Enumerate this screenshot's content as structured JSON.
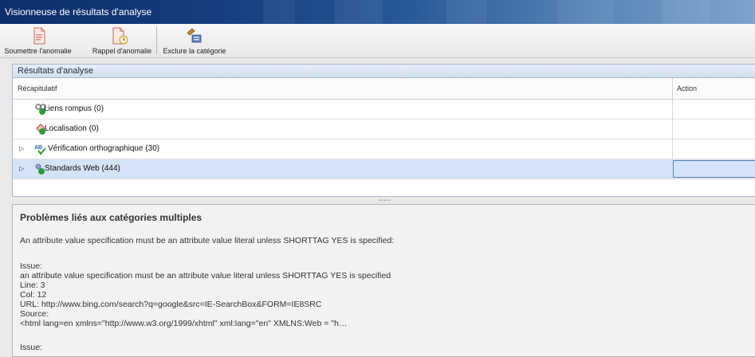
{
  "window": {
    "title": "Visionneuse de résultats d'analyse"
  },
  "toolbar": {
    "submit_label": "Soumettre l'anomalie",
    "recall_label": "Rappel d'anomalie",
    "exclude_label": "Exclure la catégorie"
  },
  "results": {
    "title": "Résultats d'analyse",
    "columns": {
      "summary": "Récapitulatif",
      "action": "Action"
    },
    "rows": [
      {
        "label": "Liens rompus (0)",
        "icon": "broken-links-icon",
        "expandable": false
      },
      {
        "label": "Localisation (0)",
        "icon": "localization-icon",
        "expandable": false
      },
      {
        "label": "Vérification orthographique (30)",
        "icon": "spellcheck-icon",
        "expandable": true
      },
      {
        "label": "Standards Web (444)",
        "icon": "web-standards-icon",
        "expandable": true,
        "selected": true
      }
    ]
  },
  "details": {
    "heading": "Problèmes liés aux catégories multiples",
    "summary": "An attribute value specification must be an attribute value literal unless SHORTTAG YES is specified:",
    "issue_label": "Issue:",
    "issue_text": "an attribute value specification must be an attribute value literal unless SHORTTAG YES is specified",
    "line": "Line: 3",
    "col": "Col: 12",
    "url": "URL: http://www.bing.com/search?q=google&src=IE-SearchBox&FORM=IE8SRC",
    "source_label": "Source:",
    "source_text": "<html lang=en xmlns=\"http://www.w3.org/1999/xhtml\" xml:lang=\"en\" XMLNS:Web = \"h…",
    "issue2_label": "Issue:"
  },
  "colors": {
    "titlebar": "#163d80",
    "selection": "#d4e3f7",
    "panel_header": "#dbe5f1"
  }
}
